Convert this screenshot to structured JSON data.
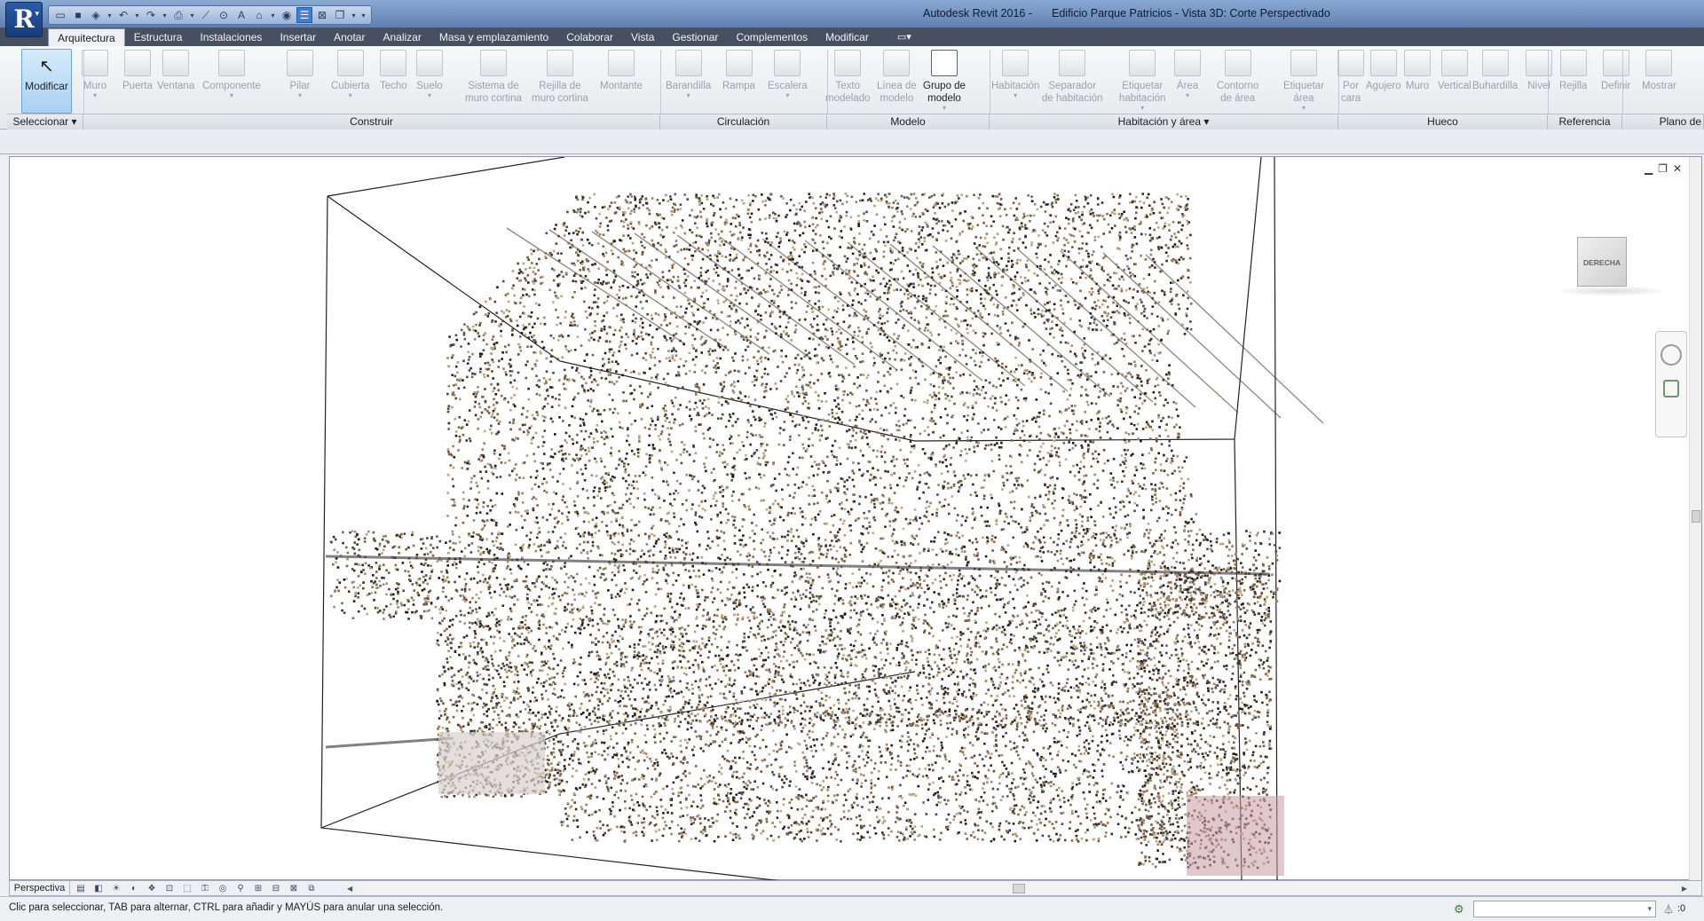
{
  "window": {
    "title_app": "Autodesk Revit 2016 -",
    "title_doc": "Edificio Parque Patricios - Vista 3D: Corte Perspectivado"
  },
  "tabs": [
    "Arquitectura",
    "Estructura",
    "Instalaciones",
    "Insertar",
    "Anotar",
    "Analizar",
    "Masa y emplazamiento",
    "Colaborar",
    "Vista",
    "Gestionar",
    "Complementos",
    "Modificar"
  ],
  "ribbon": {
    "modificar": "Modificar",
    "tools": [
      {
        "id": "muro",
        "label": "Muro",
        "dd": true
      },
      {
        "id": "puerta",
        "label": "Puerta"
      },
      {
        "id": "ventana",
        "label": "Ventana"
      },
      {
        "id": "componente",
        "label": "Componente",
        "dd": true
      },
      {
        "id": "pilar",
        "label": "Pilar",
        "dd": true
      },
      {
        "id": "cubierta",
        "label": "Cubierta",
        "dd": true
      },
      {
        "id": "techo",
        "label": "Techo"
      },
      {
        "id": "suelo",
        "label": "Suelo",
        "dd": true
      },
      {
        "id": "sistema",
        "label": "Sistema de\nmuro cortina"
      },
      {
        "id": "rejilla",
        "label": "Rejilla de\nmuro cortina"
      },
      {
        "id": "montante",
        "label": "Montante"
      },
      {
        "id": "barandilla",
        "label": "Barandilla",
        "dd": true
      },
      {
        "id": "rampa",
        "label": "Rampa"
      },
      {
        "id": "escalera",
        "label": "Escalera",
        "dd": true
      },
      {
        "id": "texto",
        "label": "Texto\nmodelado"
      },
      {
        "id": "linea",
        "label": "Línea de\nmodelo"
      },
      {
        "id": "grupo",
        "label": "Grupo de\nmodelo",
        "dd": true,
        "enabled": true
      },
      {
        "id": "habitacion",
        "label": "Habitación",
        "dd": true
      },
      {
        "id": "separador",
        "label": "Separador\nde habitación"
      },
      {
        "id": "etiquetar-hab",
        "label": "Etiquetar\nhabitación",
        "dd": true
      },
      {
        "id": "area",
        "label": "Área",
        "dd": true
      },
      {
        "id": "contorno",
        "label": "Contorno\nde área"
      },
      {
        "id": "etiquetar-area",
        "label": "Etiquetar\nárea",
        "dd": true
      },
      {
        "id": "porcara",
        "label": "Por\ncara"
      },
      {
        "id": "agujero",
        "label": "Agujero"
      },
      {
        "id": "muro2",
        "label": "Muro"
      },
      {
        "id": "vertical",
        "label": "Vertical"
      },
      {
        "id": "buhardilla",
        "label": "Buhardilla"
      },
      {
        "id": "nivel",
        "label": "Nivel"
      },
      {
        "id": "rejilla2",
        "label": "Rejilla"
      },
      {
        "id": "definir",
        "label": "Definir"
      },
      {
        "id": "mostrar",
        "label": "Mostrar"
      }
    ],
    "panels": {
      "seleccionar": "Seleccionar",
      "construir": "Construir",
      "circulacion": "Circulación",
      "modelo": "Modelo",
      "habitacion": "Habitación y área",
      "hueco": "Hueco",
      "referencia": "Referencia",
      "plano": "Plano de"
    }
  },
  "view": {
    "viewcube_face": "DERECHA",
    "scale": "Perspectiva"
  },
  "status": {
    "message": "Clic para seleccionar, TAB para alternar, CTRL para añadir y MAYÚS para anular una selección.",
    "filter_count": ":0"
  }
}
